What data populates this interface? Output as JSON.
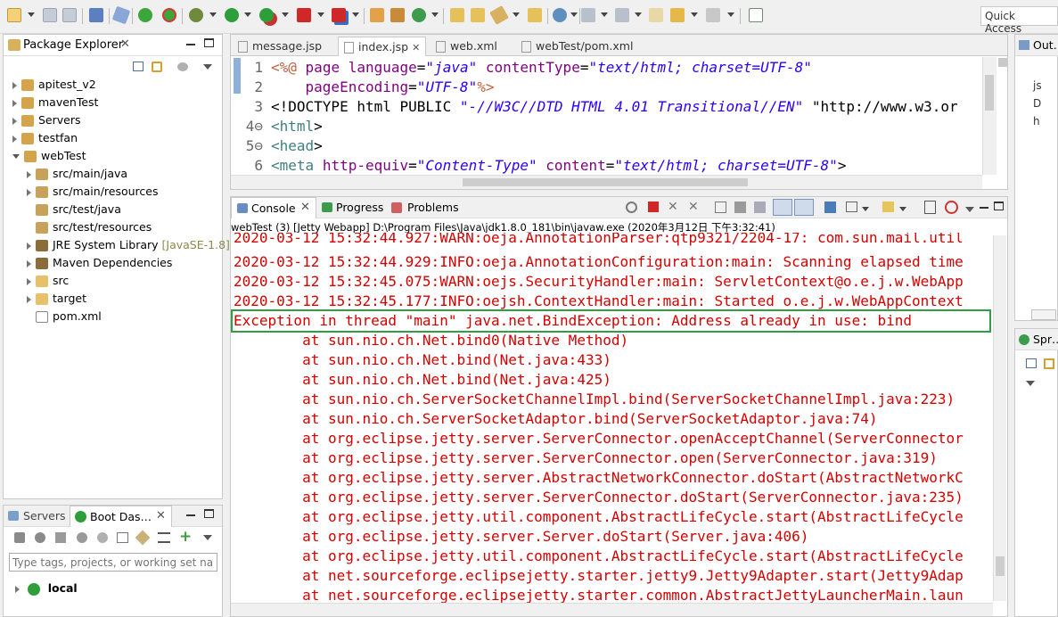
{
  "toolbar": {
    "quick_access": "Quick Access"
  },
  "package_explorer": {
    "title": "Package Explorer",
    "items": [
      {
        "label": "apitest_v2",
        "level": 0,
        "expanded": false
      },
      {
        "label": "mavenTest",
        "level": 0,
        "expanded": false
      },
      {
        "label": "Servers",
        "level": 0,
        "expanded": false
      },
      {
        "label": "testfan",
        "level": 0,
        "expanded": false
      },
      {
        "label": "webTest",
        "level": 0,
        "expanded": true
      },
      {
        "label": "src/main/java",
        "level": 1,
        "expanded": false
      },
      {
        "label": "src/main/resources",
        "level": 1,
        "expanded": false
      },
      {
        "label": "src/test/java",
        "level": 1,
        "expanded": null
      },
      {
        "label": "src/test/resources",
        "level": 1,
        "expanded": null
      },
      {
        "label": "JRE System Library",
        "suffix": "[JavaSE-1.8]",
        "level": 1,
        "expanded": false
      },
      {
        "label": "Maven Dependencies",
        "level": 1,
        "expanded": false
      },
      {
        "label": "src",
        "level": 1,
        "expanded": false
      },
      {
        "label": "target",
        "level": 1,
        "expanded": false
      },
      {
        "label": "pom.xml",
        "level": 1,
        "expanded": null
      }
    ]
  },
  "servers_panel": {
    "tab_servers": "Servers",
    "tab_boot": "Boot Das…",
    "filter_placeholder": "Type tags, projects, or working set names",
    "item": "local"
  },
  "editor": {
    "tabs": [
      "message.jsp",
      "index.jsp",
      "web.xml",
      "webTest/pom.xml"
    ],
    "active_tab": 1,
    "lines": [
      {
        "num": "1",
        "text": "<%@ page language=\"java\" contentType=\"text/html; charset=UTF-8\""
      },
      {
        "num": "2",
        "text": "    pageEncoding=\"UTF-8\"%>"
      },
      {
        "num": "3",
        "text": "<!DOCTYPE html PUBLIC \"-//W3C//DTD HTML 4.01 Transitional//EN\" \"http://www.w3.or"
      },
      {
        "num": "4⊖",
        "text": "<html>"
      },
      {
        "num": "5⊖",
        "text": "<head>"
      },
      {
        "num": "6",
        "text": "<meta http-equiv=\"Content-Type\" content=\"text/html; charset=UTF-8\">"
      }
    ]
  },
  "console": {
    "tabs": [
      "Console",
      "Progress",
      "Problems"
    ],
    "description": "webTest (3) [Jetty Webapp] D:\\Program Files\\Java\\jdk1.8.0_181\\bin\\javaw.exe (2020年3月12日 下午3:32:41)",
    "lines": [
      "2020-03-12 15:32:44.927:WARN:oeja.AnnotationParser:qtp9321/2204-17: com.sun.mail.util",
      "2020-03-12 15:32:44.929:INFO:oeja.AnnotationConfiguration:main: Scanning elapsed time",
      "2020-03-12 15:32:45.075:WARN:oejs.SecurityHandler:main: ServletContext@o.e.j.w.WebApp",
      "2020-03-12 15:32:45.177:INFO:oejsh.ContextHandler:main: Started o.e.j.w.WebAppContext",
      "Exception in thread \"main\" java.net.BindException: Address already in use: bind",
      "        at sun.nio.ch.Net.bind0(Native Method)",
      "        at sun.nio.ch.Net.bind(Net.java:433)",
      "        at sun.nio.ch.Net.bind(Net.java:425)",
      "        at sun.nio.ch.ServerSocketChannelImpl.bind(ServerSocketChannelImpl.java:223)",
      "        at sun.nio.ch.ServerSocketAdaptor.bind(ServerSocketAdaptor.java:74)",
      "        at org.eclipse.jetty.server.ServerConnector.openAcceptChannel(ServerConnector",
      "        at org.eclipse.jetty.server.ServerConnector.open(ServerConnector.java:319)",
      "        at org.eclipse.jetty.server.AbstractNetworkConnector.doStart(AbstractNetworkC",
      "        at org.eclipse.jetty.server.ServerConnector.doStart(ServerConnector.java:235)",
      "        at org.eclipse.jetty.util.component.AbstractLifeCycle.start(AbstractLifeCycle",
      "        at org.eclipse.jetty.server.Server.doStart(Server.java:406)",
      "        at org.eclipse.jetty.util.component.AbstractLifeCycle.start(AbstractLifeCycle",
      "        at net.sourceforge.eclipsejetty.starter.jetty9.Jetty9Adapter.start(Jetty9Adap",
      "        at net.sourceforge.eclipsejetty.starter.common.AbstractJettyLauncherMain.laun"
    ],
    "highlight_index": 4
  },
  "right_panels": {
    "outline_title": "Out…",
    "spring_title": "Spr…",
    "outline_items": [
      "js",
      "D",
      "h"
    ]
  },
  "colors": {
    "console_text": "#d40000",
    "highlight_border": "#2ea043",
    "keyword": "#7f0055",
    "attr": "#7f007f",
    "string": "#2a00ff"
  }
}
